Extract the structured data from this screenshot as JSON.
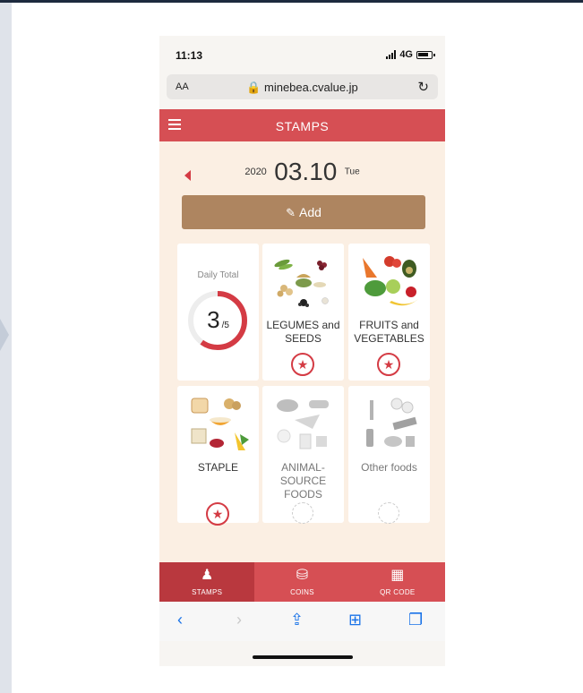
{
  "status": {
    "time": "11:13",
    "network": "4G"
  },
  "browser": {
    "text_size": "AA",
    "url": "minebea.cvalue.jp"
  },
  "header": {
    "title": "STAMPS"
  },
  "date": {
    "year": "2020",
    "month_day": "03.10",
    "weekday": "Tue"
  },
  "add_button": {
    "label": "Add"
  },
  "daily_total": {
    "label": "Daily Total",
    "count": "3",
    "goal": "/5",
    "progress": 0.6
  },
  "categories": [
    {
      "label": "LEGUMES and SEEDS",
      "stamped": true
    },
    {
      "label": "FRUITS and VEGETABLES",
      "stamped": true
    },
    {
      "label": "STAPLE",
      "stamped": true
    },
    {
      "label": "ANIMAL-SOURCE FOODS",
      "stamped": false
    },
    {
      "label": "Other foods",
      "stamped": false
    }
  ],
  "tabs": [
    {
      "label": "STAMPS",
      "icon": "stamp-icon",
      "active": true
    },
    {
      "label": "COINS",
      "icon": "coins-icon",
      "active": false
    },
    {
      "label": "QR CODE",
      "icon": "qr-code-icon",
      "active": false
    }
  ],
  "colors": {
    "accent": "#d64f54",
    "add_button": "#ae8560",
    "background": "#fbefe3",
    "stamp": "#d43b44"
  }
}
